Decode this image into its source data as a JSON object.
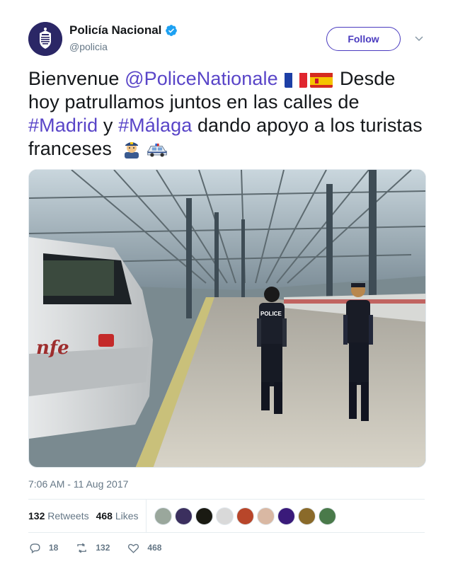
{
  "account": {
    "display_name": "Policía Nacional",
    "handle": "@policia",
    "verified": true,
    "avatar_icon": "police-crest-icon",
    "follow_label": "Follow"
  },
  "tweet": {
    "segments": [
      {
        "text": "Bienvenue ",
        "type": "text"
      },
      {
        "text": "@PoliceNationale",
        "type": "mention"
      },
      {
        "type": "emoji",
        "icon": "flag-france-icon"
      },
      {
        "type": "emoji",
        "icon": "flag-spain-icon"
      },
      {
        "text": " Desde hoy patrullamos juntos en las calles de ",
        "type": "text"
      },
      {
        "text": "#Madrid",
        "type": "hashtag"
      },
      {
        "text": " y ",
        "type": "text"
      },
      {
        "text": "#Málaga",
        "type": "hashtag"
      },
      {
        "text": " dando apoyo a los turistas franceses ",
        "type": "text"
      },
      {
        "type": "emoji",
        "icon": "police-officer-emoji-icon"
      },
      {
        "type": "emoji",
        "icon": "police-car-emoji-icon"
      }
    ],
    "timestamp": "7:06 AM - 11 Aug 2017"
  },
  "media": {
    "icon": "train-station-photo",
    "train_logo_text": "nfe",
    "vest_text": "POLICE"
  },
  "stats": {
    "retweets_count": "132",
    "retweets_label": "Retweets",
    "likes_count": "468",
    "likes_label": "Likes"
  },
  "actions": {
    "reply_count": "18",
    "retweet_count": "132",
    "like_count": "468"
  },
  "colors": {
    "link": "#5945c8",
    "follow": "#4a3bbf",
    "muted": "#657786",
    "verified": "#1da1f2"
  }
}
